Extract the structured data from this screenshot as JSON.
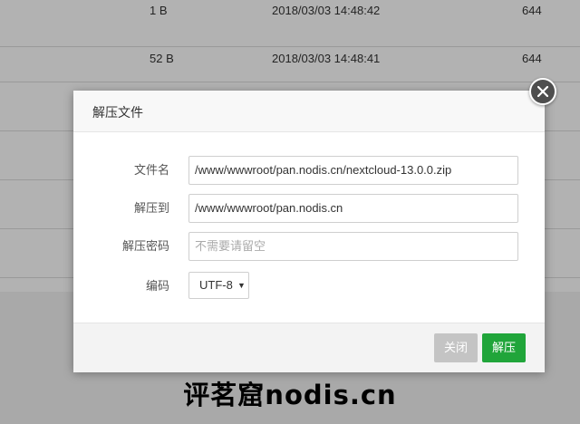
{
  "background_table": {
    "rows": [
      {
        "size": "1 B",
        "modified": "2018/03/03 14:48:42",
        "permission": "644"
      },
      {
        "size": "52 B",
        "modified": "2018/03/03 14:48:41",
        "permission": "644"
      },
      {
        "size": "",
        "modified": "",
        "permission": ""
      },
      {
        "size": "",
        "modified": "",
        "permission": ""
      },
      {
        "size": "",
        "modified": "",
        "permission": ""
      },
      {
        "size": "",
        "modified": "",
        "permission": ""
      }
    ]
  },
  "dialog": {
    "title": "解压文件",
    "close_icon": "close-icon",
    "fields": {
      "file_name": {
        "label": "文件名",
        "value": "/www/wwwroot/pan.nodis.cn/nextcloud-13.0.0.zip"
      },
      "extract_to": {
        "label": "解压到",
        "value": "/www/wwwroot/pan.nodis.cn"
      },
      "password": {
        "label": "解压密码",
        "value": "",
        "placeholder": "不需要请留空"
      },
      "encoding": {
        "label": "编码",
        "value": "UTF-8",
        "arrow": "▼"
      }
    },
    "buttons": {
      "close": "关闭",
      "extract": "解压"
    }
  },
  "watermark": "评茗窟nodis.cn",
  "colors": {
    "primary_green": "#20a53a",
    "disabled_gray": "#c4c4c4",
    "close_button_bg": "#4e4e4e"
  }
}
